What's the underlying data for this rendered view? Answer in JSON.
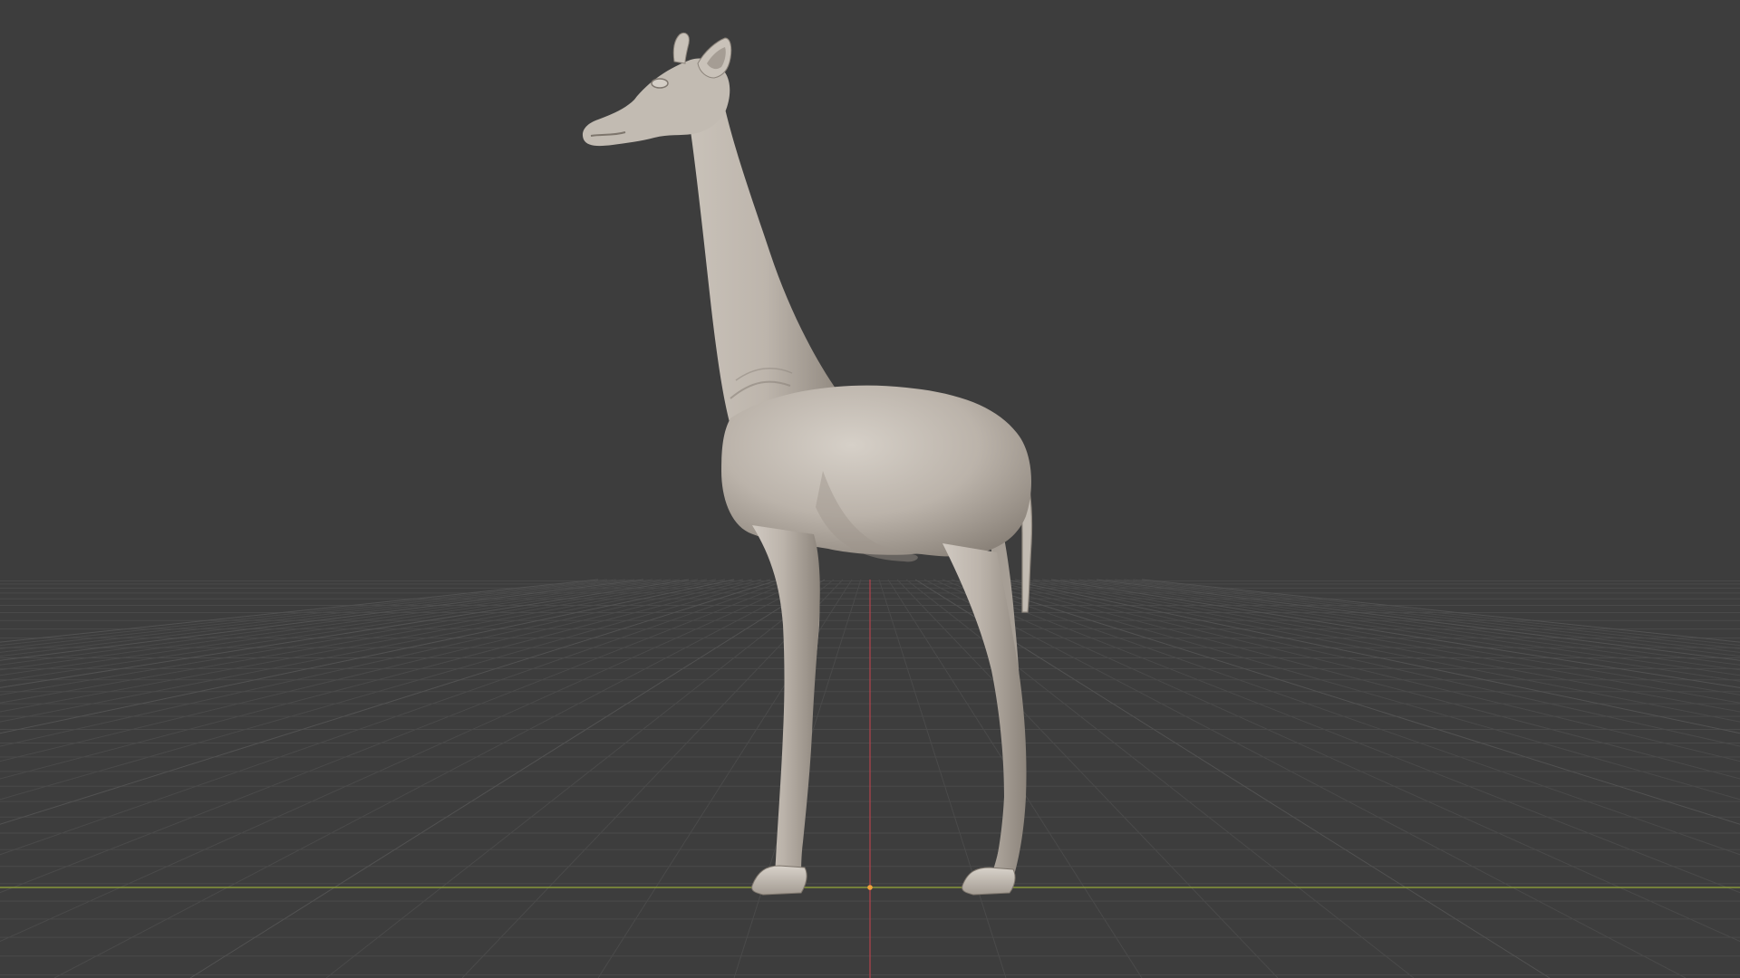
{
  "viewport": {
    "view": "front-orthographic",
    "shading": "solid",
    "object": "giraffe sculpt",
    "colors": {
      "background": "#3d3d3d",
      "grid": "#4a4a4a",
      "grid_strong": "#525252",
      "x_axis": "#87973a",
      "y_axis": "#b3424c",
      "origin": "#f2a13a",
      "model_base": "#bab3ab",
      "model_shadow": "#7f776f",
      "model_highlight": "#d4cec6"
    }
  }
}
